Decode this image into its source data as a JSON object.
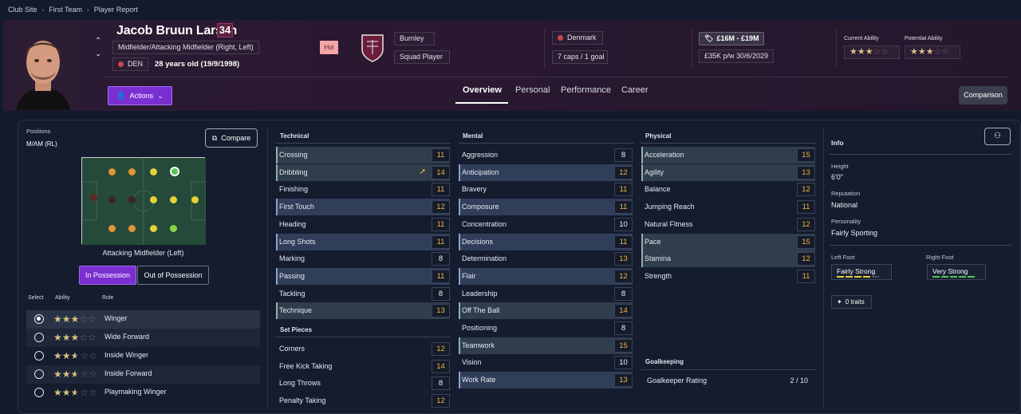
{
  "breadcrumb": [
    "Club Site",
    "First Team",
    "Player Report"
  ],
  "player": {
    "name": "Jacob Bruun Larsen",
    "number": "34",
    "positions": "Midfielder/Attacking Midfielder (Right, Left)",
    "nation_code": "DEN",
    "age_text": "28 years old (19/9/1998)",
    "status_badge": "Hol",
    "club": "Burnley",
    "squad_status": "Squad Player",
    "country": "Denmark",
    "caps": "7 caps / 1 goal",
    "value": "£16M - £19M",
    "contract": "£35K p/w  30/6/2029",
    "current_ability_label": "Current Ability",
    "potential_ability_label": "Potential Ability",
    "current_ability_stars": "★★★☆☆",
    "potential_ability_stars": "★★★☆☆"
  },
  "actions_label": "Actions",
  "tabs": [
    "Overview",
    "Personal",
    "Performance",
    "Career"
  ],
  "comparison_label": "Comparison",
  "positions_panel": {
    "label": "Positions",
    "value": "M/AM (RL)",
    "compare_label": "Compare",
    "pitch_caption": "Attacking Midfielder (Left)",
    "in_possession": "In Possession",
    "out_possession": "Out of Possession"
  },
  "roles_head": {
    "select": "Select",
    "ability": "Ability",
    "role": "Role"
  },
  "roles": [
    {
      "name": "Winger",
      "stars": 3,
      "selected": true
    },
    {
      "name": "Wide Forward",
      "stars": 3,
      "selected": false
    },
    {
      "name": "Inside Winger",
      "stars": 2.5,
      "selected": false
    },
    {
      "name": "Inside Forward",
      "stars": 2.5,
      "selected": false
    },
    {
      "name": "Playmaking Winger",
      "stars": 2.5,
      "selected": false
    }
  ],
  "technical": {
    "title": "Technical",
    "attrs": [
      {
        "name": "Crossing",
        "value": "11",
        "hl": "green"
      },
      {
        "name": "Dribbling",
        "value": "14",
        "hl": "green",
        "arrow": true
      },
      {
        "name": "Finishing",
        "value": "11",
        "hl": ""
      },
      {
        "name": "First Touch",
        "value": "12",
        "hl": "blue"
      },
      {
        "name": "Heading",
        "value": "11",
        "hl": ""
      },
      {
        "name": "Long Shots",
        "value": "11",
        "hl": "blue"
      },
      {
        "name": "Marking",
        "value": "8",
        "hl": ""
      },
      {
        "name": "Passing",
        "value": "11",
        "hl": "blue"
      },
      {
        "name": "Tackling",
        "value": "8",
        "hl": ""
      },
      {
        "name": "Technique",
        "value": "13",
        "hl": "green"
      }
    ]
  },
  "set_pieces": {
    "title": "Set Pieces",
    "attrs": [
      {
        "name": "Corners",
        "value": "12",
        "hl": ""
      },
      {
        "name": "Free Kick Taking",
        "value": "14",
        "hl": ""
      },
      {
        "name": "Long Throws",
        "value": "8",
        "hl": ""
      },
      {
        "name": "Penalty Taking",
        "value": "12",
        "hl": ""
      }
    ]
  },
  "mental": {
    "title": "Mental",
    "attrs": [
      {
        "name": "Aggression",
        "value": "8",
        "hl": ""
      },
      {
        "name": "Anticipation",
        "value": "12",
        "hl": "blue"
      },
      {
        "name": "Bravery",
        "value": "11",
        "hl": ""
      },
      {
        "name": "Composure",
        "value": "11",
        "hl": "blue"
      },
      {
        "name": "Concentration",
        "value": "10",
        "hl": ""
      },
      {
        "name": "Decisions",
        "value": "11",
        "hl": "blue"
      },
      {
        "name": "Determination",
        "value": "13",
        "hl": ""
      },
      {
        "name": "Flair",
        "value": "12",
        "hl": "blue"
      },
      {
        "name": "Leadership",
        "value": "8",
        "hl": ""
      },
      {
        "name": "Off The Ball",
        "value": "14",
        "hl": "green"
      },
      {
        "name": "Positioning",
        "value": "8",
        "hl": ""
      },
      {
        "name": "Teamwork",
        "value": "15",
        "hl": "green"
      },
      {
        "name": "Vision",
        "value": "10",
        "hl": ""
      },
      {
        "name": "Work Rate",
        "value": "13",
        "hl": "blue"
      }
    ]
  },
  "physical": {
    "title": "Physical",
    "attrs": [
      {
        "name": "Acceleration",
        "value": "15",
        "hl": "green"
      },
      {
        "name": "Agility",
        "value": "13",
        "hl": "green"
      },
      {
        "name": "Balance",
        "value": "12",
        "hl": ""
      },
      {
        "name": "Jumping Reach",
        "value": "11",
        "hl": ""
      },
      {
        "name": "Natural Fitness",
        "value": "12",
        "hl": ""
      },
      {
        "name": "Pace",
        "value": "15",
        "hl": "green"
      },
      {
        "name": "Stamina",
        "value": "12",
        "hl": "green"
      },
      {
        "name": "Strength",
        "value": "11",
        "hl": ""
      }
    ]
  },
  "goalkeeping": {
    "title": "Goalkeeping",
    "rating_label": "Goalkeeper Rating",
    "rating_value": "2 / 10"
  },
  "info": {
    "title": "Info",
    "height_label": "Height",
    "height": "6'0\"",
    "reputation_label": "Reputation",
    "reputation": "National",
    "personality_label": "Personality",
    "personality": "Fairly Sporting",
    "left_foot_label": "Left Foot",
    "left_foot": "Fairly Strong",
    "left_foot_level": 4,
    "right_foot_label": "Right Foot",
    "right_foot": "Very Strong",
    "right_foot_level": 5,
    "traits": "0 traits"
  },
  "colors": {
    "accent": "#7a2fd0",
    "value_orange": "#f1b43d",
    "green_highlight": "#2f3d4c",
    "blue_highlight": "#303e5a"
  }
}
